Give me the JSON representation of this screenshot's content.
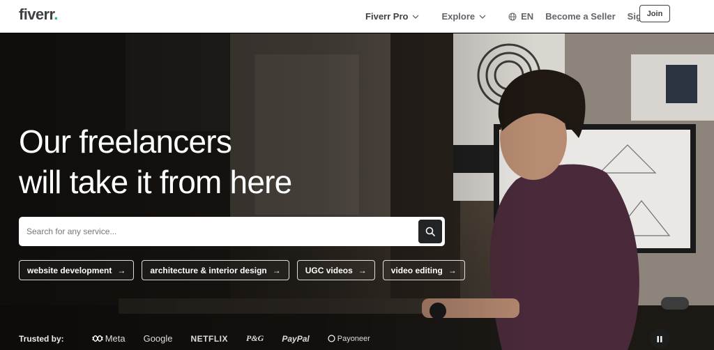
{
  "header": {
    "logo_text": "fiverr",
    "logo_dot": ".",
    "nav": {
      "pro": "Fiverr Pro",
      "explore": "Explore",
      "language": "EN",
      "seller": "Become a Seller",
      "signin": "Sign in",
      "join": "Join"
    }
  },
  "hero": {
    "headline_line1": "Our freelancers",
    "headline_line2": "will take it from here",
    "search": {
      "placeholder": "Search for any service..."
    },
    "chips": [
      {
        "label": "website development",
        "arrow": "→"
      },
      {
        "label": "architecture & interior design",
        "arrow": "→"
      },
      {
        "label": "UGC videos",
        "arrow": "→"
      },
      {
        "label": "video editing",
        "arrow": "→"
      }
    ],
    "trusted": {
      "label": "Trusted by:",
      "brands": [
        "Meta",
        "Google",
        "NETFLIX",
        "P&G",
        "PayPal",
        "Payoneer"
      ]
    }
  },
  "colors": {
    "brand_green": "#1dbf73",
    "text_dark": "#404145",
    "search_button": "#222325"
  },
  "icons": {
    "search": "search-icon",
    "globe": "globe-icon",
    "chevron": "chevron-down-icon",
    "pause": "pause-icon"
  }
}
